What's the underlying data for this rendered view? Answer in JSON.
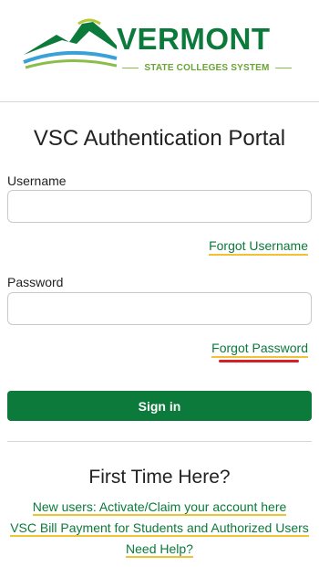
{
  "logo": {
    "word": "VERMONT",
    "subtitle": "STATE COLLEGES SYSTEM",
    "icon": "mountain-logo-icon"
  },
  "portal": {
    "title": "VSC Authentication Portal"
  },
  "form": {
    "username_label": "Username",
    "username_value": "",
    "forgot_username": "Forgot Username",
    "password_label": "Password",
    "password_value": "",
    "forgot_password": "Forgot Password",
    "signin_label": "Sign in"
  },
  "first_time": {
    "title": "First Time Here?",
    "links": [
      "New users: Activate/Claim your account here",
      "VSC Bill Payment for Students and Authorized Users",
      "Need Help?"
    ]
  },
  "colors": {
    "brand_green": "#0b7a3b",
    "accent_yellow": "#f1c232",
    "annotation_red": "#d62027"
  }
}
